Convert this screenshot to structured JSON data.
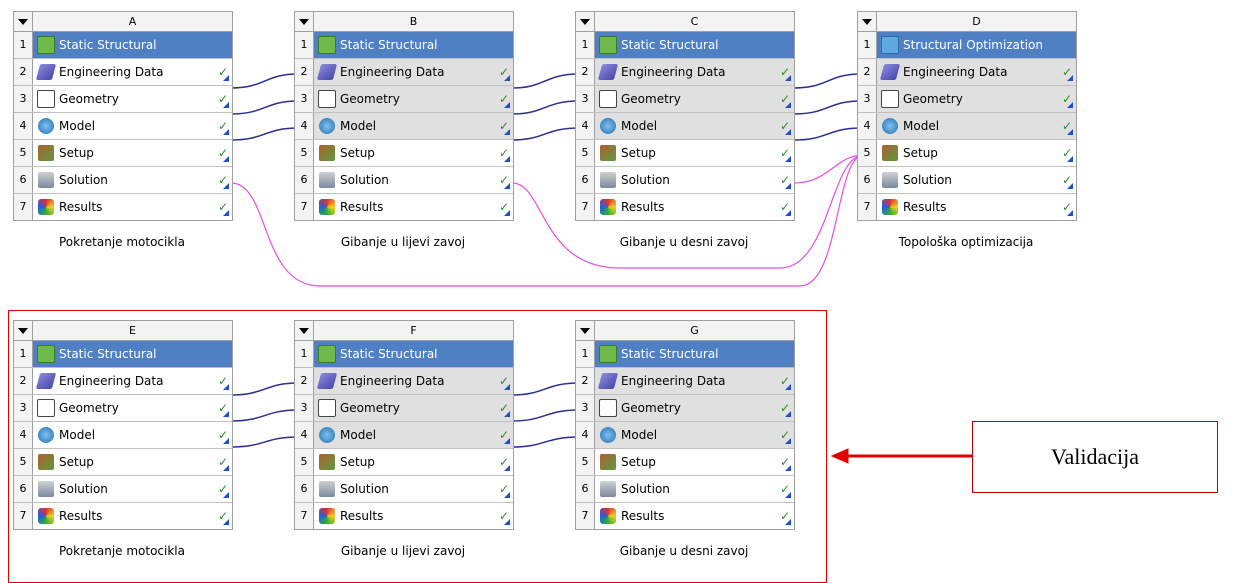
{
  "systems": [
    {
      "letter": "A",
      "title": "Static Structural",
      "title_icon": "static-structural-icon",
      "caption": "Pokretanje motocikla",
      "rows": [
        {
          "num": "1"
        },
        {
          "num": "2",
          "label": "Engineering Data",
          "icon": "engineering-data-icon"
        },
        {
          "num": "3",
          "label": "Geometry",
          "icon": "geometry-icon"
        },
        {
          "num": "4",
          "label": "Model",
          "icon": "model-icon"
        },
        {
          "num": "5",
          "label": "Setup",
          "icon": "setup-icon"
        },
        {
          "num": "6",
          "label": "Solution",
          "icon": "solution-icon"
        },
        {
          "num": "7",
          "label": "Results",
          "icon": "results-icon"
        }
      ]
    },
    {
      "letter": "B",
      "title": "Static Structural",
      "caption": "Gibanje u lijevi zavoj",
      "rows": [
        {
          "num": "1"
        },
        {
          "num": "2",
          "label": "Engineering Data"
        },
        {
          "num": "3",
          "label": "Geometry"
        },
        {
          "num": "4",
          "label": "Model"
        },
        {
          "num": "5",
          "label": "Setup"
        },
        {
          "num": "6",
          "label": "Solution"
        },
        {
          "num": "7",
          "label": "Results"
        }
      ]
    },
    {
      "letter": "C",
      "title": "Static Structural",
      "caption": "Gibanje u desni zavoj",
      "rows": [
        {
          "num": "1"
        },
        {
          "num": "2",
          "label": "Engineering Data"
        },
        {
          "num": "3",
          "label": "Geometry"
        },
        {
          "num": "4",
          "label": "Model"
        },
        {
          "num": "5",
          "label": "Setup"
        },
        {
          "num": "6",
          "label": "Solution"
        },
        {
          "num": "7",
          "label": "Results"
        }
      ]
    },
    {
      "letter": "D",
      "title": "Structural Optimization",
      "title_icon": "structural-optimization-icon",
      "caption": "Topološka optimizacija",
      "rows": [
        {
          "num": "1"
        },
        {
          "num": "2",
          "label": "Engineering Data"
        },
        {
          "num": "3",
          "label": "Geometry"
        },
        {
          "num": "4",
          "label": "Model"
        },
        {
          "num": "5",
          "label": "Setup"
        },
        {
          "num": "6",
          "label": "Solution"
        },
        {
          "num": "7",
          "label": "Results"
        }
      ]
    },
    {
      "letter": "E",
      "title": "Static Structural",
      "caption": "Pokretanje motocikla",
      "rows": [
        {
          "num": "1"
        },
        {
          "num": "2",
          "label": "Engineering Data"
        },
        {
          "num": "3",
          "label": "Geometry"
        },
        {
          "num": "4",
          "label": "Model"
        },
        {
          "num": "5",
          "label": "Setup"
        },
        {
          "num": "6",
          "label": "Solution"
        },
        {
          "num": "7",
          "label": "Results"
        }
      ]
    },
    {
      "letter": "F",
      "title": "Static Structural",
      "caption": "Gibanje u lijevi zavoj",
      "rows": [
        {
          "num": "1"
        },
        {
          "num": "2",
          "label": "Engineering Data"
        },
        {
          "num": "3",
          "label": "Geometry"
        },
        {
          "num": "4",
          "label": "Model"
        },
        {
          "num": "5",
          "label": "Setup"
        },
        {
          "num": "6",
          "label": "Solution"
        },
        {
          "num": "7",
          "label": "Results"
        }
      ]
    },
    {
      "letter": "G",
      "title": "Static Structural",
      "caption": "Gibanje u desni zavoj",
      "rows": [
        {
          "num": "1"
        },
        {
          "num": "2",
          "label": "Engineering Data"
        },
        {
          "num": "3",
          "label": "Geometry"
        },
        {
          "num": "4",
          "label": "Model"
        },
        {
          "num": "5",
          "label": "Setup"
        },
        {
          "num": "6",
          "label": "Solution"
        },
        {
          "num": "7",
          "label": "Results"
        }
      ]
    }
  ],
  "check_glyph": "✓",
  "annotation_label": "Validacija",
  "colors": {
    "title_bar": "#4f80c4",
    "link": "#2b2f8f",
    "solution_link": "#e050e0",
    "validation_frame": "#e00000"
  }
}
